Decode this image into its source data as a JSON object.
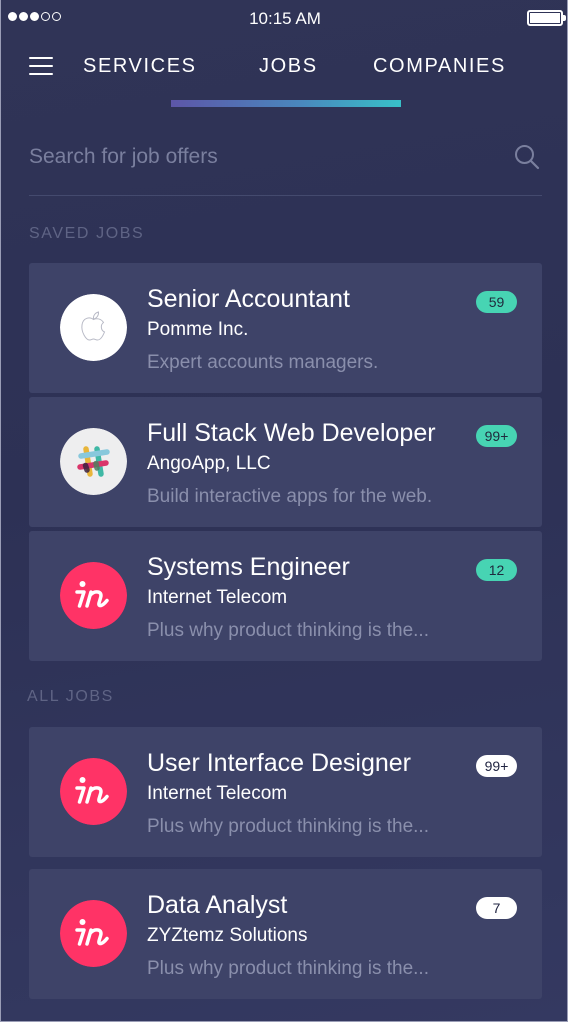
{
  "status_bar": {
    "time": "10:15 AM",
    "signal_filled": 3,
    "signal_total": 5,
    "battery_level": 1.0
  },
  "nav": {
    "menu_icon": "hamburger-menu-icon",
    "tabs": [
      {
        "label": "SERVICES"
      },
      {
        "label": "JOBS",
        "active": true
      },
      {
        "label": "COMPANIES"
      }
    ],
    "indicator_gradient": [
      "#5d56a8",
      "#38c0c8"
    ]
  },
  "search": {
    "placeholder": "Search for job offers",
    "value": "",
    "icon": "search-icon"
  },
  "saved_jobs": {
    "label": "SAVED JOBS",
    "items": [
      {
        "title": "Senior Accountant",
        "company": "Pomme Inc.",
        "description": "Expert accounts managers.",
        "badge": "59",
        "badge_style": "teal",
        "logo": "apple-logo"
      },
      {
        "title": "Full Stack Web Developer",
        "company": "AngoApp, LLC",
        "description": "Build interactive apps for the web.",
        "badge": "99+",
        "badge_style": "teal",
        "logo": "slack-logo"
      },
      {
        "title": "Systems Engineer",
        "company": "Internet Telecom",
        "description": "Plus why product thinking is the...",
        "badge": "12",
        "badge_style": "teal",
        "logo": "invision-logo"
      }
    ]
  },
  "all_jobs": {
    "label": "ALL JOBS",
    "items": [
      {
        "title": "User Interface Designer",
        "company": "Internet Telecom",
        "description": "Plus why product thinking is the...",
        "badge": "99+",
        "badge_style": "white",
        "logo": "invision-logo"
      },
      {
        "title": "Data Analyst",
        "company": "ZYZtemz Solutions",
        "description": "Plus why product thinking is the...",
        "badge": "7",
        "badge_style": "white",
        "logo": "invision-logo"
      }
    ]
  },
  "colors": {
    "background": "#303457",
    "card": "#3e4368",
    "badge_teal": "#47d4b3",
    "badge_white": "#ffffff",
    "invision_pink": "#ff3366"
  }
}
